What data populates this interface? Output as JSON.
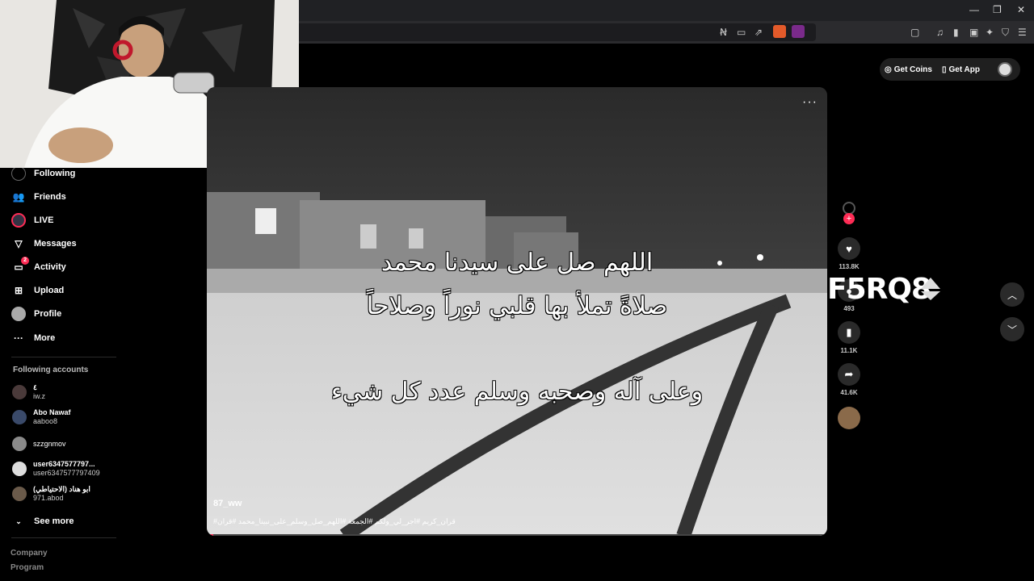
{
  "browser": {
    "window_controls": [
      "—",
      "❐",
      "✕"
    ]
  },
  "header": {
    "get_coins": "Get Coins",
    "get_app": "Get App"
  },
  "sidebar": {
    "items": [
      {
        "label": "Following",
        "icon": "following-icon"
      },
      {
        "label": "Friends",
        "icon": "friends-icon"
      },
      {
        "label": "LIVE",
        "icon": "live-icon"
      },
      {
        "label": "Messages",
        "icon": "messages-icon"
      },
      {
        "label": "Activity",
        "icon": "activity-icon",
        "badge": "2"
      },
      {
        "label": "Upload",
        "icon": "upload-icon"
      },
      {
        "label": "Profile",
        "icon": "profile-icon"
      },
      {
        "label": "More",
        "icon": "more-icon"
      }
    ],
    "following_title": "Following accounts",
    "accounts": [
      {
        "name": "٤",
        "handle": "iw.z"
      },
      {
        "name": "Abo Nawaf",
        "handle": "aaboo8"
      },
      {
        "name": "szzgnmov",
        "handle": ""
      },
      {
        "name": "user6347577797...",
        "handle": "user6347577797409"
      },
      {
        "name": "ابو هناد (الاحتياطي)",
        "handle": "971.abod"
      }
    ],
    "see_more": "See more",
    "footer": [
      "Company",
      "Program"
    ]
  },
  "video": {
    "caption_lines": [
      "اللهم صل على سيدنا محمد",
      "صلاةً تملأ بها قلبي نوراً وصلاحاً",
      "وعلى آله وصحبه وسلم عدد كل شيء"
    ],
    "username": "87_ww",
    "hashtags": "#قران_كريم #اجر_لي_ولكم #الجمعة #اللهم_صل_وسلم_على_نبينا_محمد #قران",
    "progress": 0.01
  },
  "actions": {
    "likes": "113.8K",
    "comments": "493",
    "saves": "11.1K",
    "shares": "41.6K"
  },
  "overlay": {
    "code": "F5RQ8"
  },
  "colors": {
    "accent": "#fe2c55",
    "background": "#000000"
  }
}
